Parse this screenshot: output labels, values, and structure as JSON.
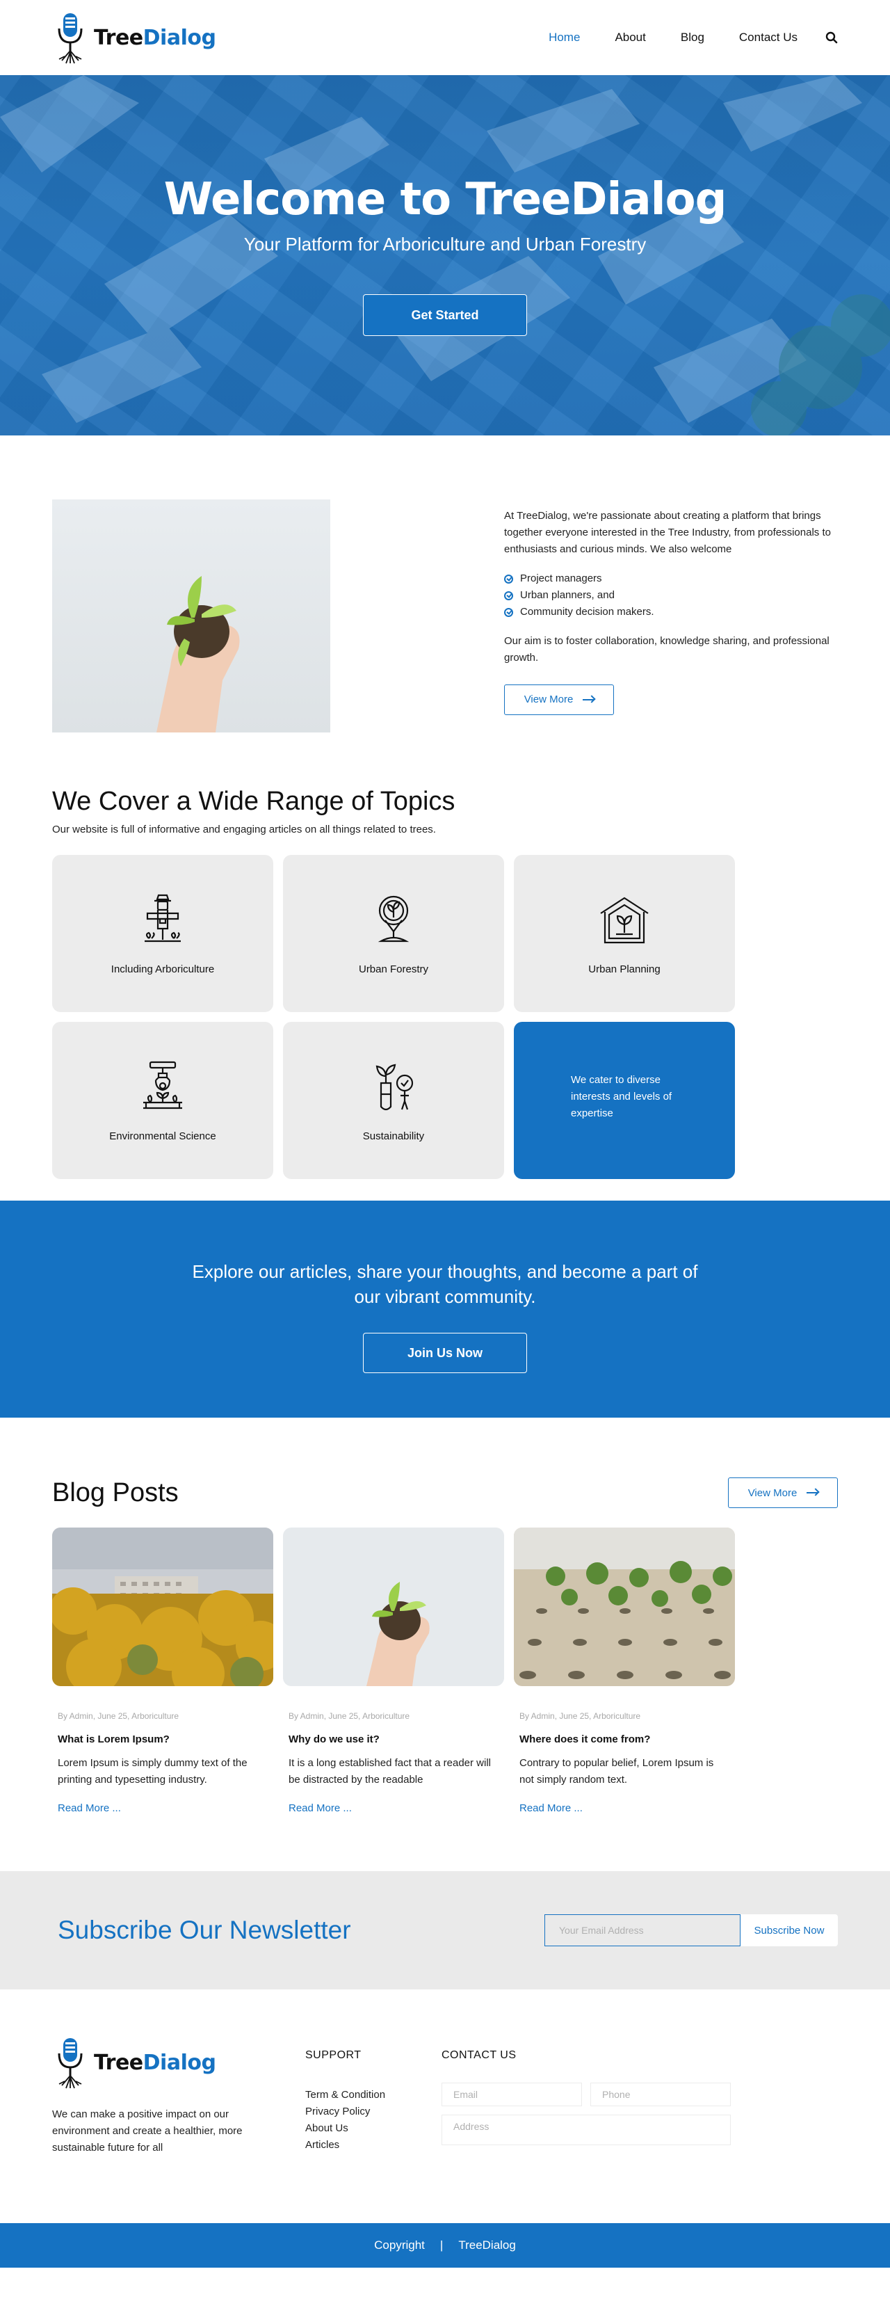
{
  "brand": {
    "name_part1": "Tree",
    "name_part2": "Dialog",
    "accent": "#1572c2"
  },
  "nav": {
    "items": [
      "Home",
      "About",
      "Blog",
      "Contact Us"
    ],
    "active": "Home"
  },
  "hero": {
    "title": "Welcome  to TreeDialog",
    "subtitle": "Your Platform for Arboriculture and Urban Forestry",
    "button": "Get Started"
  },
  "about": {
    "intro": "At TreeDialog, we're passionate about creating a platform that brings together everyone interested in the Tree Industry, from professionals to enthusiasts and curious minds. We also welcome",
    "list": [
      "Project managers",
      "Urban planners, and",
      "Community decision makers."
    ],
    "aim": "Our aim is to foster collaboration, knowledge sharing, and professional growth.",
    "button": "View More"
  },
  "topics": {
    "title": "We Cover a Wide Range of Topics",
    "subtitle": "Our website is full of informative and engaging articles on all things related to trees.",
    "cards": [
      {
        "label": "Including Arboriculture",
        "icon": "scarecrow-icon"
      },
      {
        "label": "Urban Forestry",
        "icon": "location-plant-icon"
      },
      {
        "label": "Urban Planning",
        "icon": "greenhouse-icon"
      },
      {
        "label": "Environmental Science",
        "icon": "robot-arm-plant-icon"
      },
      {
        "label": "Sustainability",
        "icon": "test-tube-plant-icon"
      },
      {
        "label": "We cater to diverse interests and levels of expertise"
      }
    ]
  },
  "cta": {
    "text": "Explore our articles, share your thoughts, and become a part of our vibrant community.",
    "button": "Join Us Now"
  },
  "blog": {
    "title": "Blog Posts",
    "button": "View More",
    "posts": [
      {
        "meta": "By Admin, June 25, Arboriculture",
        "title": "What is Lorem Ipsum?",
        "excerpt": "Lorem Ipsum is simply dummy text of the printing and typesetting industry.",
        "link": "Read More  ..."
      },
      {
        "meta": "By Admin, June 25, Arboriculture",
        "title": "Why do we use it?",
        "excerpt": "It is a long established fact that a reader will be distracted by the readable",
        "link": "Read More  ..."
      },
      {
        "meta": "By Admin, June 25, Arboriculture",
        "title": "Where does it come from?",
        "excerpt": "Contrary to popular belief, Lorem Ipsum is not simply random text.",
        "link": "Read More  ..."
      }
    ]
  },
  "newsletter": {
    "title": "Subscribe Our Newsletter",
    "placeholder": "Your Email Address",
    "button": "Subscribe Now"
  },
  "footer": {
    "about": "We can make a positive impact on our environment and create a healthier, more sustainable future for all",
    "support_title": "SUPPORT",
    "support_links": [
      "Term & Condition",
      "Privacy Policy",
      "About Us",
      "Articles"
    ],
    "contact_title": "CONTACT US",
    "email_placeholder": "Email",
    "phone_placeholder": "Phone",
    "address_placeholder": "Address"
  },
  "copyright": {
    "left": "Copyright",
    "sep": "|",
    "right": "TreeDialog"
  }
}
